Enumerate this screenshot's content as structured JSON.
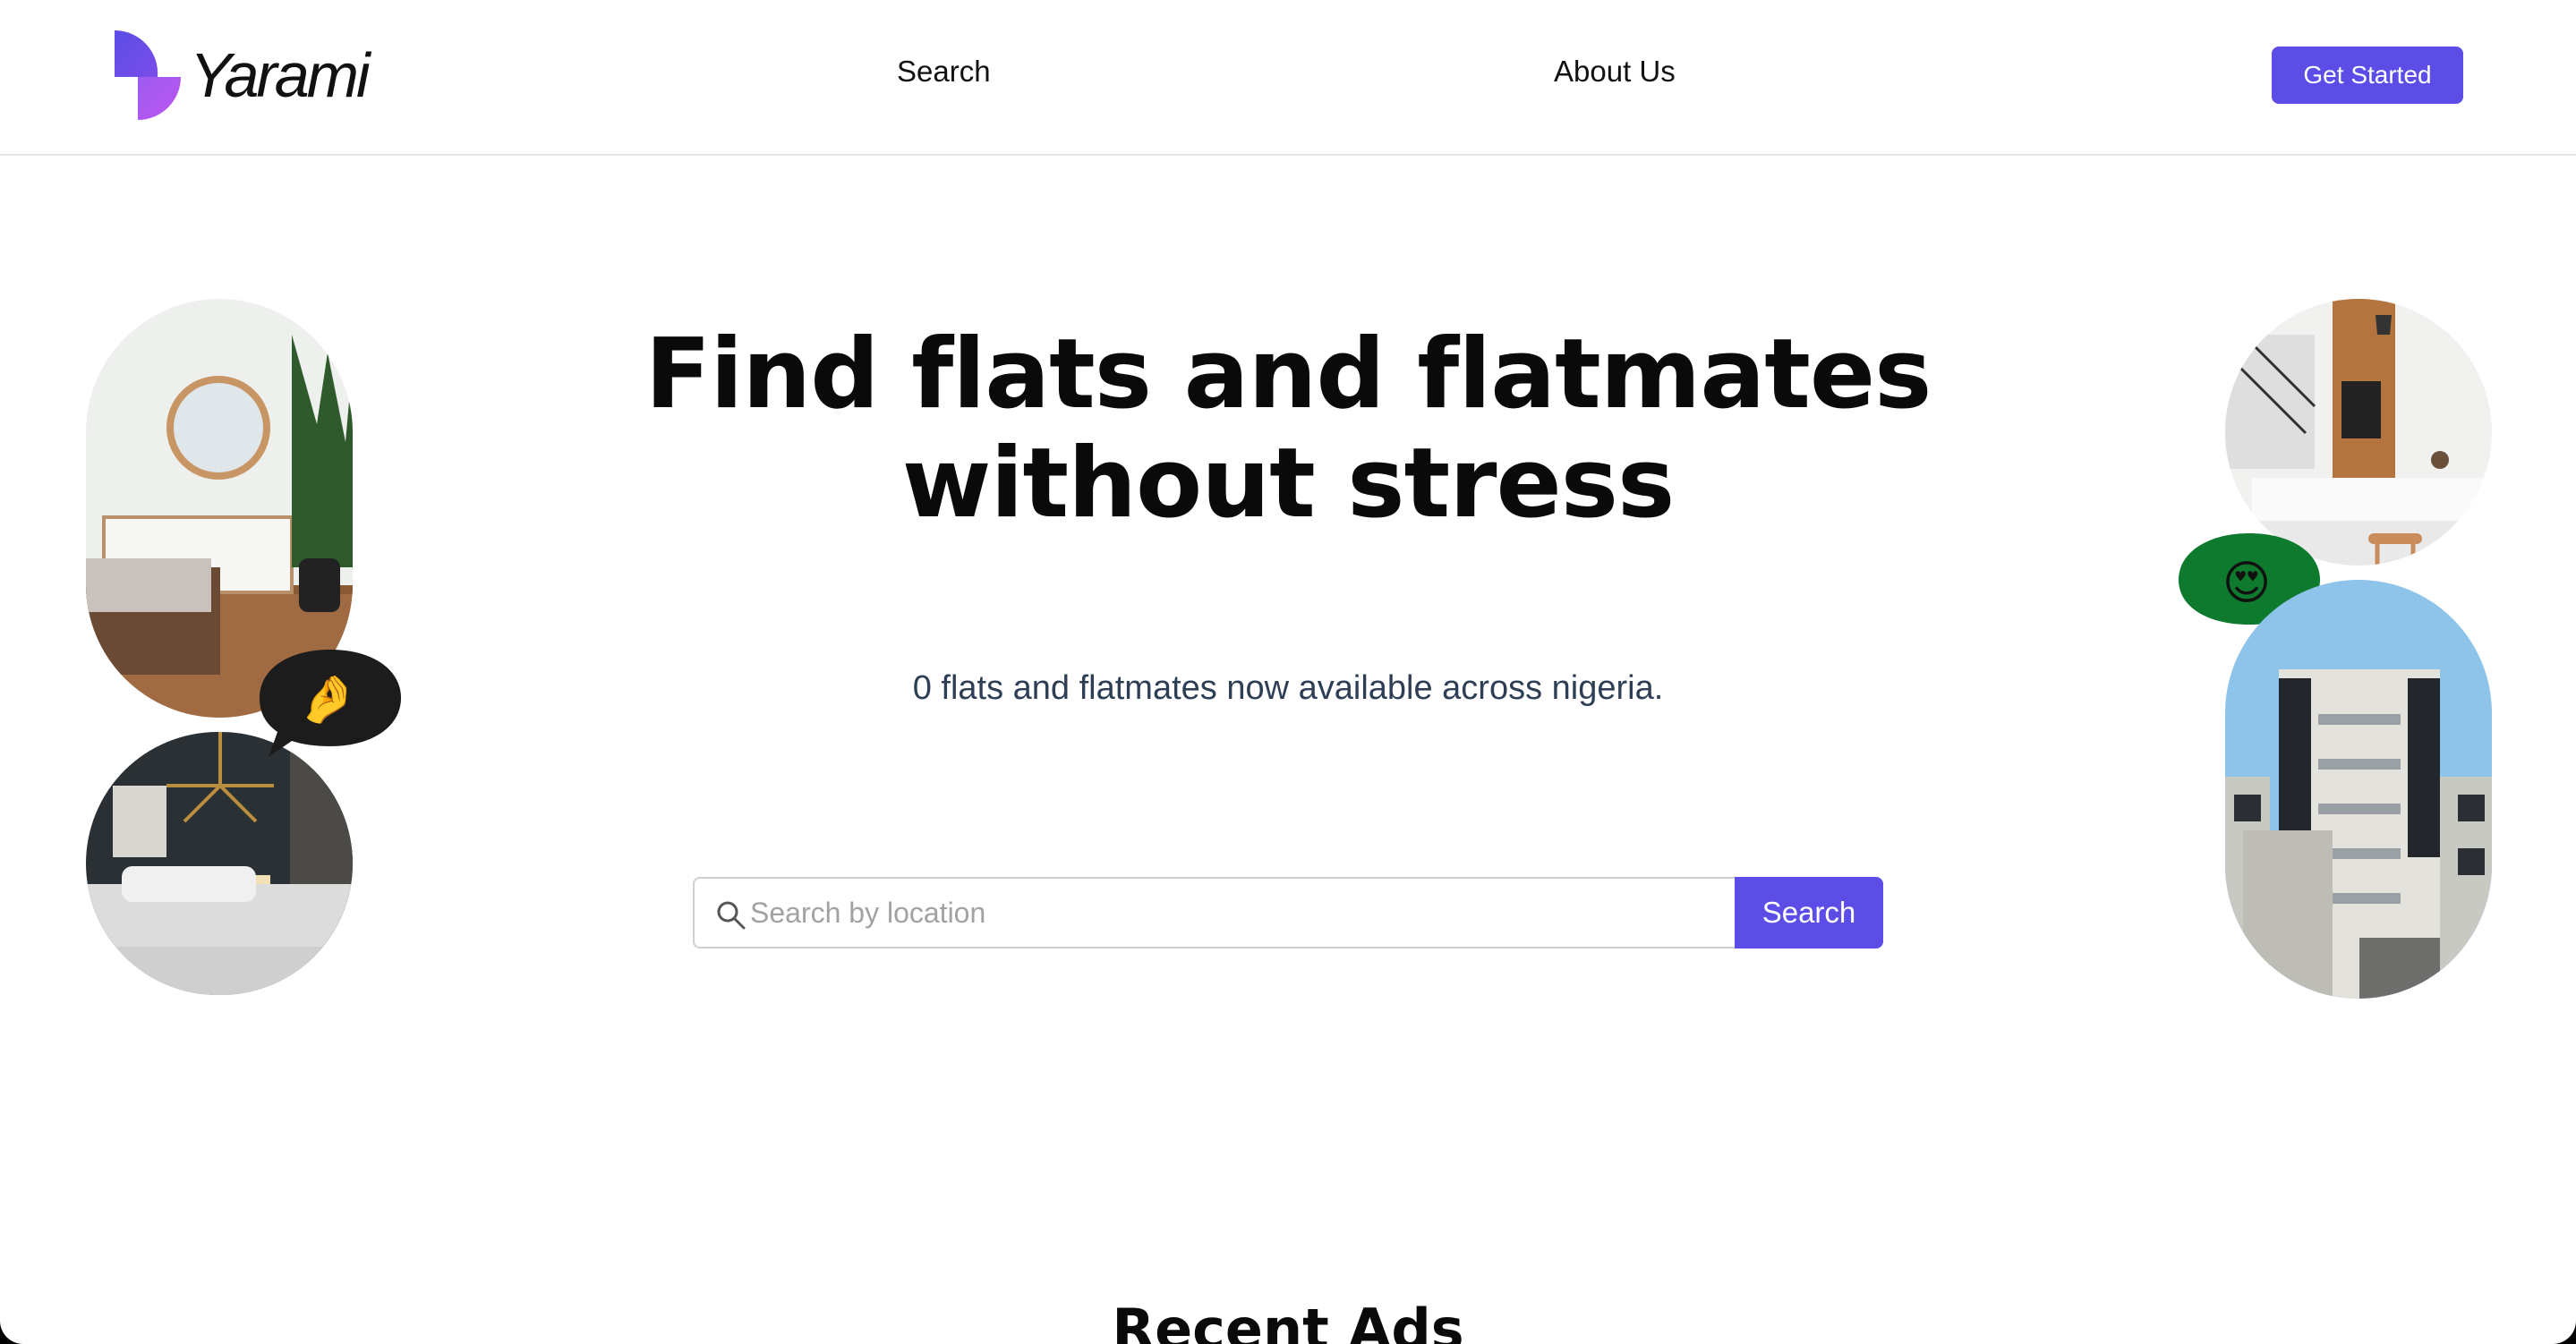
{
  "header": {
    "brand": "Yarami",
    "nav": {
      "search": "Search",
      "about": "About Us"
    },
    "cta": "Get Started"
  },
  "hero": {
    "title": "Find flats and flatmates without stress",
    "subtitle": "0 flats and flatmates now available across nigeria.",
    "search": {
      "placeholder": "Search by location",
      "value": "",
      "button": "Search"
    }
  },
  "decor": {
    "emoji_left": "🤌",
    "emoji_right": "😍",
    "colors": {
      "accent": "#5b4de6",
      "bubble_dark": "#1c1c1c",
      "bubble_green": "#0d7a2e"
    },
    "icons": [
      "search-icon",
      "logo-mark-icon"
    ]
  },
  "recent": {
    "title": "Recent Ads"
  }
}
